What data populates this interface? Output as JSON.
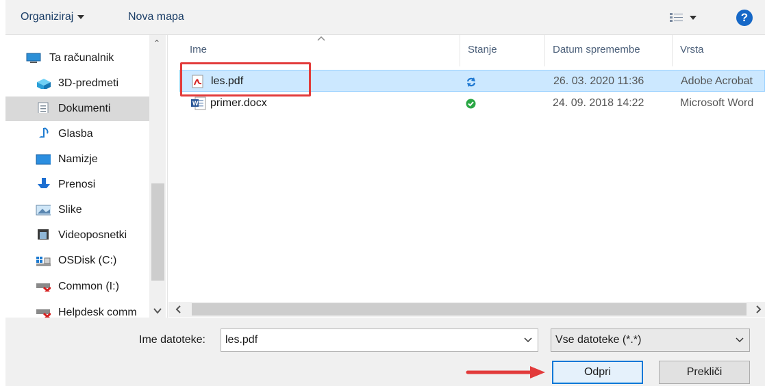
{
  "toolbar": {
    "organize": "Organiziraj",
    "new_folder": "Nova mapa"
  },
  "nav": {
    "items": [
      {
        "label": "Ta računalnik",
        "icon": "computer-icon"
      },
      {
        "label": "3D-predmeti",
        "icon": "3d-objects-icon"
      },
      {
        "label": "Dokumenti",
        "icon": "documents-icon",
        "selected": true
      },
      {
        "label": "Glasba",
        "icon": "music-icon"
      },
      {
        "label": "Namizje",
        "icon": "desktop-icon"
      },
      {
        "label": "Prenosi",
        "icon": "downloads-icon"
      },
      {
        "label": "Slike",
        "icon": "pictures-icon"
      },
      {
        "label": "Videoposnetki",
        "icon": "videos-icon"
      },
      {
        "label": "OSDisk (C:)",
        "icon": "drive-icon"
      },
      {
        "label": "Common (I:)",
        "icon": "network-drive-disconnected-icon"
      },
      {
        "label": "Helpdesk comm",
        "icon": "network-drive-disconnected-icon"
      }
    ]
  },
  "list": {
    "columns": {
      "name": "Ime",
      "status": "Stanje",
      "date": "Datum spremembe",
      "type": "Vrsta"
    },
    "rows": [
      {
        "name": "les.pdf",
        "date": "26. 03. 2020 11:36",
        "type": "Adobe Acrobat",
        "status": "sync-icon",
        "selected": true
      },
      {
        "name": "primer.docx",
        "date": "24. 09. 2018 14:22",
        "type": "Microsoft Word",
        "status": "available-icon"
      }
    ]
  },
  "bottom": {
    "filename_label": "Ime datoteke:",
    "filename_value": "les.pdf",
    "filter_value": "Vse datoteke (*.*)",
    "open": "Odpri",
    "cancel": "Prekliči"
  },
  "colors": {
    "highlight_box": "#e23b3b",
    "selection": "#cce8ff",
    "primary_border": "#0078d7"
  }
}
